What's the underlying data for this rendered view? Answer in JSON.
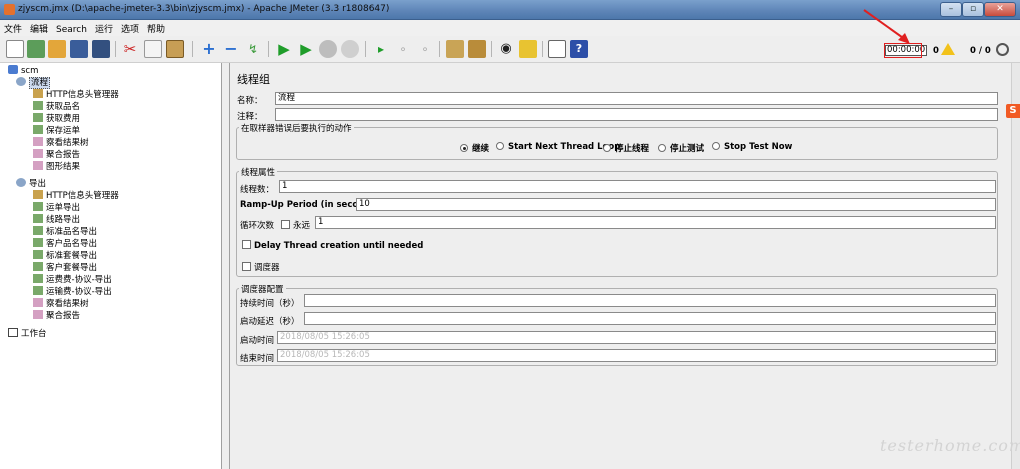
{
  "window": {
    "title": "zjyscm.jmx (D:\\apache-jmeter-3.3\\bin\\zjyscm.jmx) - Apache JMeter (3.3 r1808647)"
  },
  "menu": [
    "文件",
    "编辑",
    "Search",
    "运行",
    "选项",
    "帮助"
  ],
  "status": {
    "timer": "00:00:00",
    "warnings": "0",
    "threads": "0 / 0"
  },
  "tree": {
    "root": "scm",
    "groups": [
      {
        "label": "流程",
        "children": [
          "HTTP信息头管理器",
          "获取品名",
          "获取费用",
          "保存运单",
          "察看结果树",
          "聚合报告",
          "图形结果"
        ]
      },
      {
        "label": "导出",
        "children": [
          "HTTP信息头管理器",
          "运单导出",
          "线路导出",
          "标准品名导出",
          "客户品名导出",
          "标准套餐导出",
          "客户套餐导出",
          "运费费-协议-导出",
          "运输费-协议-导出",
          "察看结果树",
          "聚合报告"
        ]
      }
    ],
    "workbench": "工作台"
  },
  "panel": {
    "title": "线程组",
    "name_label": "名称：",
    "name_value": "流程",
    "comment_label": "注释：",
    "comment_value": "",
    "error_section": {
      "legend": "在取样器错误后要执行的动作",
      "options": [
        "继续",
        "Start Next Thread Loop",
        "停止线程",
        "停止测试",
        "Stop Test Now"
      ],
      "selected": "继续"
    },
    "thread_props": {
      "legend": "线程属性",
      "threads_label": "线程数：",
      "threads_value": "1",
      "rampup_label": "Ramp-Up Period (in seconds):",
      "rampup_value": "10",
      "loop_label": "循环次数",
      "forever_label": "永远",
      "loop_value": "1",
      "delay_label": "Delay Thread creation until needed",
      "scheduler_label": "调度器"
    },
    "scheduler": {
      "legend": "调度器配置",
      "duration_label": "持续时间（秒）",
      "duration_value": "",
      "startup_label": "启动延迟（秒）",
      "startup_value": "",
      "start_label": "启动时间",
      "start_value": "2018/08/05 15:26:05",
      "end_label": "结束时间",
      "end_value": "2018/08/05 15:26:05"
    }
  },
  "watermark": "testerhome.com",
  "colors": {
    "titlebar": "#5f86b8",
    "accent_red": "#e02020",
    "green_run": "#1f9d2a"
  }
}
